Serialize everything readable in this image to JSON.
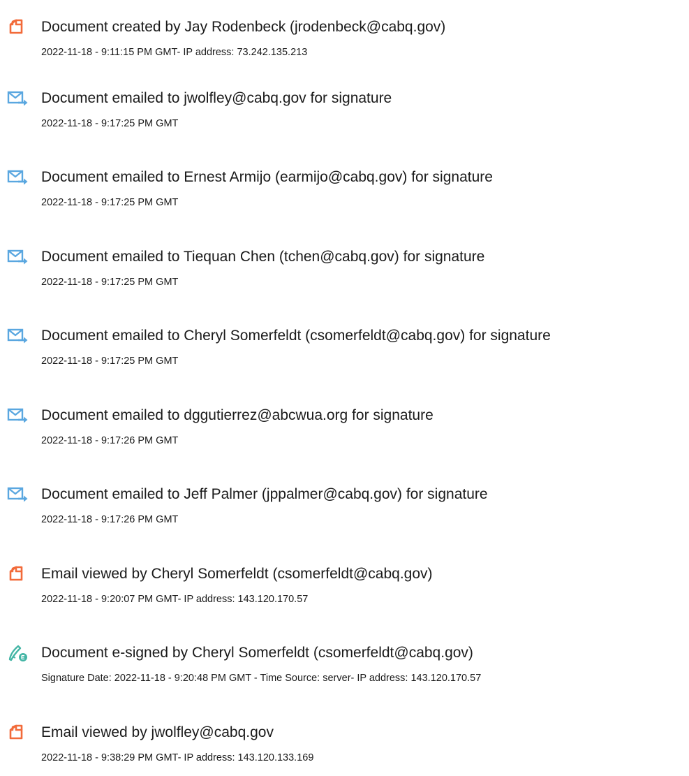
{
  "colors": {
    "document_icon": "#f26b3a",
    "email_icon": "#5aa7e0",
    "sign_icon": "#43b5a5",
    "text": "#1a1a1a"
  },
  "events": [
    {
      "icon": "document-icon",
      "title": "Document created by Jay Rodenbeck (jrodenbeck@cabq.gov)",
      "detail": "2022-11-18 - 9:11:15 PM GMT- IP address: 73.242.135.213"
    },
    {
      "icon": "email-icon",
      "title": "Document emailed to jwolfley@cabq.gov for signature",
      "detail": "2022-11-18 - 9:17:25 PM GMT"
    },
    {
      "icon": "email-icon",
      "title": "Document emailed to Ernest Armijo (earmijo@cabq.gov) for signature",
      "detail": "2022-11-18 - 9:17:25 PM GMT"
    },
    {
      "icon": "email-icon",
      "title": "Document emailed to Tiequan Chen (tchen@cabq.gov) for signature",
      "detail": "2022-11-18 - 9:17:25 PM GMT"
    },
    {
      "icon": "email-icon",
      "title": "Document emailed to Cheryl Somerfeldt (csomerfeldt@cabq.gov) for signature",
      "detail": "2022-11-18 - 9:17:25 PM GMT"
    },
    {
      "icon": "email-icon",
      "title": "Document emailed to dggutierrez@abcwua.org for signature",
      "detail": "2022-11-18 - 9:17:26 PM GMT"
    },
    {
      "icon": "email-icon",
      "title": "Document emailed to Jeff Palmer (jppalmer@cabq.gov) for signature",
      "detail": "2022-11-18 - 9:17:26 PM GMT"
    },
    {
      "icon": "document-icon",
      "title": "Email viewed by Cheryl Somerfeldt (csomerfeldt@cabq.gov)",
      "detail": "2022-11-18 - 9:20:07 PM GMT- IP address: 143.120.170.57"
    },
    {
      "icon": "esign-icon",
      "title": "Document e-signed by Cheryl Somerfeldt (csomerfeldt@cabq.gov)",
      "detail": "Signature Date: 2022-11-18 - 9:20:48 PM GMT - Time Source: server- IP address: 143.120.170.57"
    },
    {
      "icon": "document-icon",
      "title": "Email viewed by jwolfley@cabq.gov",
      "detail": "2022-11-18 - 9:38:29 PM GMT- IP address: 143.120.133.169"
    }
  ]
}
